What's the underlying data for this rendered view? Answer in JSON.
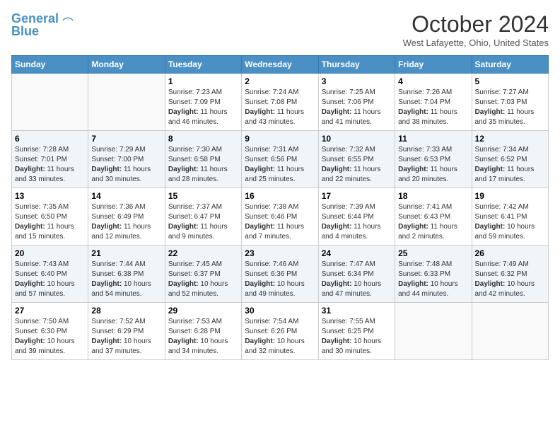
{
  "header": {
    "logo_line1": "General",
    "logo_line2": "Blue",
    "month": "October 2024",
    "location": "West Lafayette, Ohio, United States"
  },
  "weekdays": [
    "Sunday",
    "Monday",
    "Tuesday",
    "Wednesday",
    "Thursday",
    "Friday",
    "Saturday"
  ],
  "weeks": [
    [
      {
        "day": "",
        "sunrise": "",
        "sunset": "",
        "daylight": ""
      },
      {
        "day": "",
        "sunrise": "",
        "sunset": "",
        "daylight": ""
      },
      {
        "day": "1",
        "sunrise": "Sunrise: 7:23 AM",
        "sunset": "Sunset: 7:09 PM",
        "daylight": "Daylight: 11 hours and 46 minutes."
      },
      {
        "day": "2",
        "sunrise": "Sunrise: 7:24 AM",
        "sunset": "Sunset: 7:08 PM",
        "daylight": "Daylight: 11 hours and 43 minutes."
      },
      {
        "day": "3",
        "sunrise": "Sunrise: 7:25 AM",
        "sunset": "Sunset: 7:06 PM",
        "daylight": "Daylight: 11 hours and 41 minutes."
      },
      {
        "day": "4",
        "sunrise": "Sunrise: 7:26 AM",
        "sunset": "Sunset: 7:04 PM",
        "daylight": "Daylight: 11 hours and 38 minutes."
      },
      {
        "day": "5",
        "sunrise": "Sunrise: 7:27 AM",
        "sunset": "Sunset: 7:03 PM",
        "daylight": "Daylight: 11 hours and 35 minutes."
      }
    ],
    [
      {
        "day": "6",
        "sunrise": "Sunrise: 7:28 AM",
        "sunset": "Sunset: 7:01 PM",
        "daylight": "Daylight: 11 hours and 33 minutes."
      },
      {
        "day": "7",
        "sunrise": "Sunrise: 7:29 AM",
        "sunset": "Sunset: 7:00 PM",
        "daylight": "Daylight: 11 hours and 30 minutes."
      },
      {
        "day": "8",
        "sunrise": "Sunrise: 7:30 AM",
        "sunset": "Sunset: 6:58 PM",
        "daylight": "Daylight: 11 hours and 28 minutes."
      },
      {
        "day": "9",
        "sunrise": "Sunrise: 7:31 AM",
        "sunset": "Sunset: 6:56 PM",
        "daylight": "Daylight: 11 hours and 25 minutes."
      },
      {
        "day": "10",
        "sunrise": "Sunrise: 7:32 AM",
        "sunset": "Sunset: 6:55 PM",
        "daylight": "Daylight: 11 hours and 22 minutes."
      },
      {
        "day": "11",
        "sunrise": "Sunrise: 7:33 AM",
        "sunset": "Sunset: 6:53 PM",
        "daylight": "Daylight: 11 hours and 20 minutes."
      },
      {
        "day": "12",
        "sunrise": "Sunrise: 7:34 AM",
        "sunset": "Sunset: 6:52 PM",
        "daylight": "Daylight: 11 hours and 17 minutes."
      }
    ],
    [
      {
        "day": "13",
        "sunrise": "Sunrise: 7:35 AM",
        "sunset": "Sunset: 6:50 PM",
        "daylight": "Daylight: 11 hours and 15 minutes."
      },
      {
        "day": "14",
        "sunrise": "Sunrise: 7:36 AM",
        "sunset": "Sunset: 6:49 PM",
        "daylight": "Daylight: 11 hours and 12 minutes."
      },
      {
        "day": "15",
        "sunrise": "Sunrise: 7:37 AM",
        "sunset": "Sunset: 6:47 PM",
        "daylight": "Daylight: 11 hours and 9 minutes."
      },
      {
        "day": "16",
        "sunrise": "Sunrise: 7:38 AM",
        "sunset": "Sunset: 6:46 PM",
        "daylight": "Daylight: 11 hours and 7 minutes."
      },
      {
        "day": "17",
        "sunrise": "Sunrise: 7:39 AM",
        "sunset": "Sunset: 6:44 PM",
        "daylight": "Daylight: 11 hours and 4 minutes."
      },
      {
        "day": "18",
        "sunrise": "Sunrise: 7:41 AM",
        "sunset": "Sunset: 6:43 PM",
        "daylight": "Daylight: 11 hours and 2 minutes."
      },
      {
        "day": "19",
        "sunrise": "Sunrise: 7:42 AM",
        "sunset": "Sunset: 6:41 PM",
        "daylight": "Daylight: 10 hours and 59 minutes."
      }
    ],
    [
      {
        "day": "20",
        "sunrise": "Sunrise: 7:43 AM",
        "sunset": "Sunset: 6:40 PM",
        "daylight": "Daylight: 10 hours and 57 minutes."
      },
      {
        "day": "21",
        "sunrise": "Sunrise: 7:44 AM",
        "sunset": "Sunset: 6:38 PM",
        "daylight": "Daylight: 10 hours and 54 minutes."
      },
      {
        "day": "22",
        "sunrise": "Sunrise: 7:45 AM",
        "sunset": "Sunset: 6:37 PM",
        "daylight": "Daylight: 10 hours and 52 minutes."
      },
      {
        "day": "23",
        "sunrise": "Sunrise: 7:46 AM",
        "sunset": "Sunset: 6:36 PM",
        "daylight": "Daylight: 10 hours and 49 minutes."
      },
      {
        "day": "24",
        "sunrise": "Sunrise: 7:47 AM",
        "sunset": "Sunset: 6:34 PM",
        "daylight": "Daylight: 10 hours and 47 minutes."
      },
      {
        "day": "25",
        "sunrise": "Sunrise: 7:48 AM",
        "sunset": "Sunset: 6:33 PM",
        "daylight": "Daylight: 10 hours and 44 minutes."
      },
      {
        "day": "26",
        "sunrise": "Sunrise: 7:49 AM",
        "sunset": "Sunset: 6:32 PM",
        "daylight": "Daylight: 10 hours and 42 minutes."
      }
    ],
    [
      {
        "day": "27",
        "sunrise": "Sunrise: 7:50 AM",
        "sunset": "Sunset: 6:30 PM",
        "daylight": "Daylight: 10 hours and 39 minutes."
      },
      {
        "day": "28",
        "sunrise": "Sunrise: 7:52 AM",
        "sunset": "Sunset: 6:29 PM",
        "daylight": "Daylight: 10 hours and 37 minutes."
      },
      {
        "day": "29",
        "sunrise": "Sunrise: 7:53 AM",
        "sunset": "Sunset: 6:28 PM",
        "daylight": "Daylight: 10 hours and 34 minutes."
      },
      {
        "day": "30",
        "sunrise": "Sunrise: 7:54 AM",
        "sunset": "Sunset: 6:26 PM",
        "daylight": "Daylight: 10 hours and 32 minutes."
      },
      {
        "day": "31",
        "sunrise": "Sunrise: 7:55 AM",
        "sunset": "Sunset: 6:25 PM",
        "daylight": "Daylight: 10 hours and 30 minutes."
      },
      {
        "day": "",
        "sunrise": "",
        "sunset": "",
        "daylight": ""
      },
      {
        "day": "",
        "sunrise": "",
        "sunset": "",
        "daylight": ""
      }
    ]
  ]
}
